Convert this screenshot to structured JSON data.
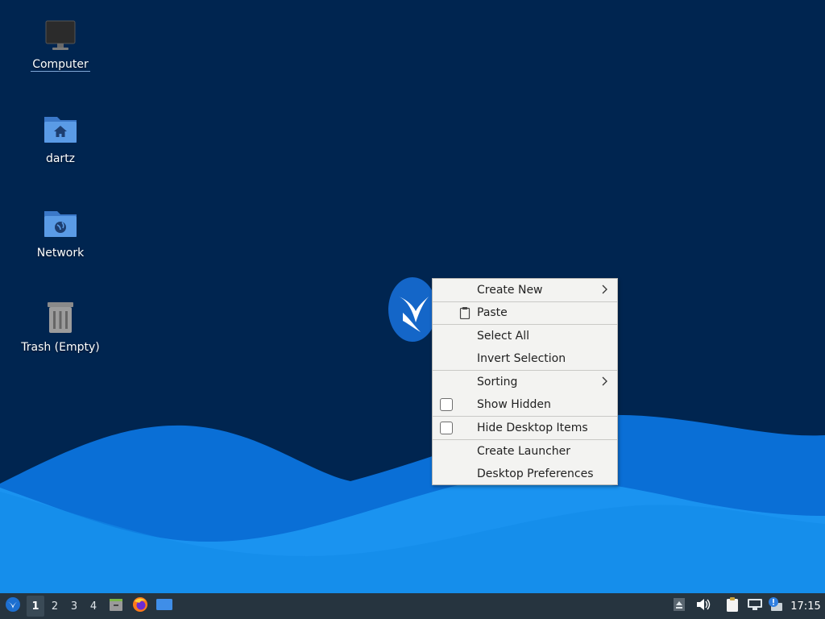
{
  "desktop": {
    "icons": [
      {
        "label": "Computer",
        "icon": "computer-icon"
      },
      {
        "label": "dartz",
        "icon": "home-folder-icon"
      },
      {
        "label": "Network",
        "icon": "network-folder-icon"
      },
      {
        "label": "Trash (Empty)",
        "icon": "trash-icon"
      }
    ]
  },
  "context_menu": {
    "items": [
      {
        "label": "Create New",
        "submenu": true
      },
      {
        "label": "Paste",
        "icon": "clipboard-icon"
      },
      {
        "label": "Select All"
      },
      {
        "label": "Invert Selection"
      },
      {
        "label": "Sorting",
        "submenu": true
      },
      {
        "label": "Show Hidden",
        "checkbox": true,
        "checked": false
      },
      {
        "label": "Hide Desktop Items",
        "checkbox": true,
        "checked": false
      },
      {
        "label": "Create Launcher"
      },
      {
        "label": "Desktop Preferences"
      }
    ]
  },
  "taskbar": {
    "menu_icon": "app-menu-bird-icon",
    "workspaces": [
      "1",
      "2",
      "3",
      "4"
    ],
    "active_workspace": "1",
    "launchers": [
      "file-manager-icon",
      "firefox-icon",
      "show-desktop-icon"
    ],
    "tray": [
      "eject-icon",
      "volume-icon",
      "clipboard-icon",
      "network-icon",
      "update-notifier-icon"
    ],
    "clock": "17:15"
  },
  "colors": {
    "desktop_bg": "#002550",
    "wave_light": "#1a93f0",
    "wave_mid": "#0a6fd6",
    "taskbar_bg": "#26343f",
    "menu_bg": "#f3f3f1"
  }
}
